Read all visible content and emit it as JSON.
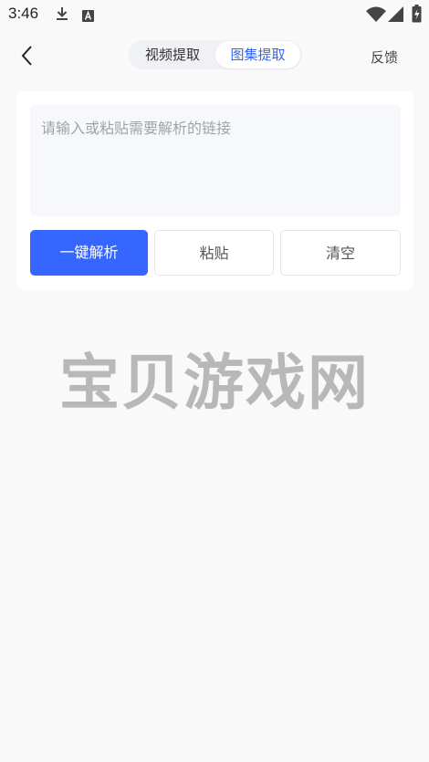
{
  "status_bar": {
    "time": "3:46",
    "icons": [
      "download-icon",
      "a-icon",
      "wifi-icon",
      "signal-icon",
      "battery-icon"
    ]
  },
  "header": {
    "tabs": [
      {
        "label": "视频提取",
        "active": false
      },
      {
        "label": "图集提取",
        "active": true
      }
    ],
    "feedback_label": "反馈"
  },
  "input": {
    "value": "",
    "placeholder": "请输入或粘贴需要解析的链接"
  },
  "buttons": {
    "parse_label": "一键解析",
    "paste_label": "粘贴",
    "clear_label": "清空"
  },
  "watermark": "宝贝游戏网",
  "colors": {
    "accent": "#3566ff",
    "active_tab_text": "#3566ee",
    "background": "#f9f9f9"
  }
}
